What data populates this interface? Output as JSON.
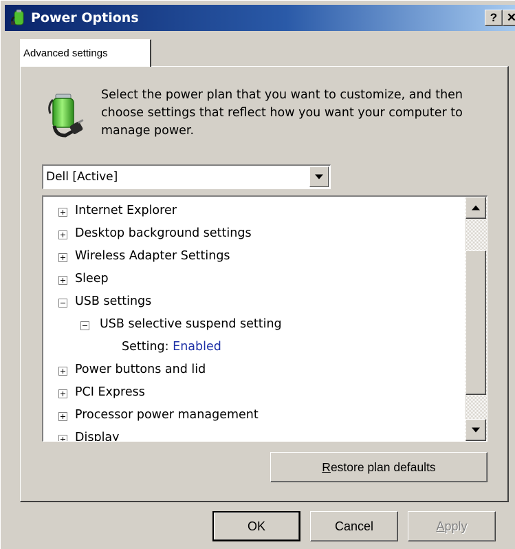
{
  "window": {
    "title": "Power Options",
    "help_label": "?",
    "close_label": "✕"
  },
  "tabs": [
    {
      "label": "Advanced settings"
    }
  ],
  "description": "Select the power plan that you want to customize, and then choose settings that reflect how you want your computer to manage power.",
  "plan_select": {
    "selected": "Dell [Active]"
  },
  "tree": {
    "items": [
      {
        "label": "Internet Explorer",
        "expanded": false,
        "level": 0
      },
      {
        "label": "Desktop background settings",
        "expanded": false,
        "level": 0
      },
      {
        "label": "Wireless Adapter Settings",
        "expanded": false,
        "level": 0
      },
      {
        "label": "Sleep",
        "expanded": false,
        "level": 0
      },
      {
        "label": "USB settings",
        "expanded": true,
        "level": 0
      },
      {
        "label": "USB selective suspend setting",
        "expanded": true,
        "level": 1
      },
      {
        "setting_label": "Setting:",
        "setting_value": "Enabled",
        "level": 2
      },
      {
        "label": "Power buttons and lid",
        "expanded": false,
        "level": 0
      },
      {
        "label": "PCI Express",
        "expanded": false,
        "level": 0
      },
      {
        "label": "Processor power management",
        "expanded": false,
        "level": 0
      },
      {
        "label": "Display",
        "expanded": false,
        "level": 0
      }
    ]
  },
  "buttons": {
    "restore": {
      "mnemonic": "R",
      "rest": "estore plan defaults"
    },
    "ok": "OK",
    "cancel": "Cancel",
    "apply": {
      "mnemonic": "A",
      "rest": "pply"
    }
  },
  "colors": {
    "title_gradient_start": "#0a246a",
    "title_gradient_end": "#a6caf0",
    "setting_value": "#1c2fa6",
    "dialog_face": "#d4d0c8"
  },
  "icons": {
    "title": "power-plug-icon",
    "plan": "battery-plug-icon"
  }
}
